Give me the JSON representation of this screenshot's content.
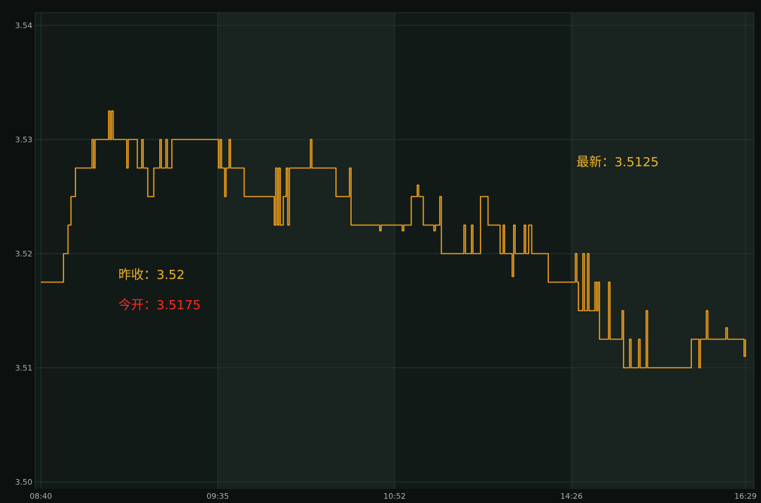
{
  "chart_data": {
    "type": "line",
    "title": "",
    "xlabel": "",
    "ylabel": "",
    "x_ticks": [
      "08:40",
      "09:35",
      "10:52",
      "14:26",
      "16:29"
    ],
    "y_ticks": [
      "3.50",
      "3.51",
      "3.52",
      "3.53",
      "3.54"
    ],
    "ylim": [
      3.5,
      3.54
    ],
    "grid": true,
    "colors": {
      "background": "#0c100f",
      "plot_band_dark": "#121a18",
      "plot_band_light": "#19231f",
      "grid": "#1f3a33",
      "line": "#f5a21c",
      "label_gold": "#f0b429",
      "label_red": "#ff2d1f",
      "axis_text": "#a7b3b0"
    },
    "annotations": [
      {
        "id": "prev-close",
        "label": "昨收：",
        "value": "3.52",
        "color": "label_gold"
      },
      {
        "id": "open",
        "label": "今开：",
        "value": "3.5175",
        "color": "label_red"
      },
      {
        "id": "latest",
        "label": "最新：",
        "value": "3.5125",
        "color": "label_gold"
      }
    ],
    "series": [
      {
        "values": [
          3.5175,
          3.5175,
          3.5175,
          3.5175,
          3.5175,
          3.5175,
          3.5175,
          3.5175,
          3.5175,
          3.5175,
          3.5175,
          3.5175,
          3.5175,
          3.5175,
          3.5175,
          3.52,
          3.52,
          3.52,
          3.5225,
          3.5225,
          3.525,
          3.525,
          3.525,
          3.5275,
          3.5275,
          3.5275,
          3.5275,
          3.5275,
          3.5275,
          3.5275,
          3.5275,
          3.5275,
          3.5275,
          3.5275,
          3.53,
          3.5275,
          3.53,
          3.53,
          3.53,
          3.53,
          3.53,
          3.53,
          3.53,
          3.53,
          3.53,
          3.5325,
          3.53,
          3.5325,
          3.53,
          3.53,
          3.53,
          3.53,
          3.53,
          3.53,
          3.53,
          3.53,
          3.53,
          3.5275,
          3.53,
          3.53,
          3.53,
          3.53,
          3.53,
          3.53,
          3.5275,
          3.5275,
          3.5275,
          3.53,
          3.5275,
          3.5275,
          3.5275,
          3.525,
          3.525,
          3.525,
          3.525,
          3.5275,
          3.5275,
          3.5275,
          3.5275,
          3.53,
          3.5275,
          3.5275,
          3.5275,
          3.53,
          3.5275,
          3.5275,
          3.5275,
          3.53,
          3.53,
          3.53,
          3.53,
          3.53,
          3.53,
          3.53,
          3.53,
          3.53,
          3.53,
          3.53,
          3.53,
          3.53,
          3.53,
          3.53,
          3.53,
          3.53,
          3.53,
          3.53,
          3.53,
          3.53,
          3.53,
          3.53,
          3.53,
          3.53,
          3.53,
          3.53,
          3.53,
          3.53,
          3.53,
          3.53,
          3.5275,
          3.53,
          3.5275,
          3.5275,
          3.525,
          3.5275,
          3.5275,
          3.53,
          3.5275,
          3.5275,
          3.5275,
          3.5275,
          3.5275,
          3.5275,
          3.5275,
          3.5275,
          3.5275,
          3.525,
          3.525,
          3.525,
          3.525,
          3.525,
          3.525,
          3.525,
          3.525,
          3.525,
          3.525,
          3.525,
          3.525,
          3.525,
          3.525,
          3.525,
          3.525,
          3.525,
          3.525,
          3.525,
          3.525,
          3.5225,
          3.5275,
          3.5225,
          3.5275,
          3.5225,
          3.5225,
          3.525,
          3.525,
          3.5275,
          3.5225,
          3.5275,
          3.5275,
          3.5275,
          3.5275,
          3.5275,
          3.5275,
          3.5275,
          3.5275,
          3.5275,
          3.5275,
          3.5275,
          3.5275,
          3.5275,
          3.5275,
          3.53,
          3.5275,
          3.5275,
          3.5275,
          3.5275,
          3.5275,
          3.5275,
          3.5275,
          3.5275,
          3.5275,
          3.5275,
          3.5275,
          3.5275,
          3.5275,
          3.5275,
          3.5275,
          3.5275,
          3.525,
          3.525,
          3.525,
          3.525,
          3.525,
          3.525,
          3.525,
          3.525,
          3.525,
          3.5275,
          3.5225,
          3.5225,
          3.5225,
          3.5225,
          3.5225,
          3.5225,
          3.5225,
          3.5225,
          3.5225,
          3.5225,
          3.5225,
          3.5225,
          3.5225,
          3.5225,
          3.5225,
          3.5225,
          3.5225,
          3.5225,
          3.5225,
          3.522,
          3.5225,
          3.5225,
          3.5225,
          3.5225,
          3.5225,
          3.5225,
          3.5225,
          3.5225,
          3.5225,
          3.5225,
          3.5225,
          3.5225,
          3.5225,
          3.5225,
          3.522,
          3.5225,
          3.5225,
          3.5225,
          3.5225,
          3.5225,
          3.525,
          3.525,
          3.525,
          3.525,
          3.526,
          3.525,
          3.525,
          3.525,
          3.5225,
          3.5225,
          3.5225,
          3.5225,
          3.5225,
          3.5225,
          3.5225,
          3.522,
          3.5225,
          3.5225,
          3.5225,
          3.525,
          3.52,
          3.52,
          3.52,
          3.52,
          3.52,
          3.52,
          3.52,
          3.52,
          3.52,
          3.52,
          3.52,
          3.52,
          3.52,
          3.52,
          3.52,
          3.5225,
          3.52,
          3.52,
          3.52,
          3.52,
          3.5225,
          3.52,
          3.52,
          3.52,
          3.52,
          3.52,
          3.525,
          3.525,
          3.525,
          3.525,
          3.525,
          3.5225,
          3.5225,
          3.5225,
          3.5225,
          3.5225,
          3.5225,
          3.5225,
          3.5225,
          3.52,
          3.52,
          3.5225,
          3.52,
          3.52,
          3.52,
          3.52,
          3.52,
          3.518,
          3.5225,
          3.52,
          3.52,
          3.52,
          3.52,
          3.52,
          3.52,
          3.5225,
          3.52,
          3.52,
          3.5225,
          3.5225,
          3.52,
          3.52,
          3.52,
          3.52,
          3.52,
          3.52,
          3.52,
          3.52,
          3.52,
          3.52,
          3.52,
          3.5175,
          3.5175,
          3.5175,
          3.5175,
          3.5175,
          3.5175,
          3.5175,
          3.5175,
          3.5175,
          3.5175,
          3.5175,
          3.5175,
          3.5175,
          3.5175,
          3.5175,
          3.5175,
          3.5175,
          3.5175,
          3.52,
          3.5175,
          3.515,
          3.515,
          3.515,
          3.52,
          3.515,
          3.515,
          3.52,
          3.515,
          3.515,
          3.515,
          3.515,
          3.5175,
          3.515,
          3.5175,
          3.5125,
          3.5125,
          3.5125,
          3.5125,
          3.5125,
          3.5125,
          3.5175,
          3.5125,
          3.5125,
          3.5125,
          3.5125,
          3.5125,
          3.5125,
          3.5125,
          3.5125,
          3.515,
          3.51,
          3.51,
          3.51,
          3.51,
          3.5125,
          3.51,
          3.51,
          3.51,
          3.51,
          3.51,
          3.5125,
          3.51,
          3.51,
          3.51,
          3.51,
          3.515,
          3.51,
          3.51,
          3.51,
          3.51,
          3.51,
          3.51,
          3.51,
          3.51,
          3.51,
          3.51,
          3.51,
          3.51,
          3.51,
          3.51,
          3.51,
          3.51,
          3.51,
          3.51,
          3.51,
          3.51,
          3.51,
          3.51,
          3.51,
          3.51,
          3.51,
          3.51,
          3.51,
          3.51,
          3.51,
          3.5125,
          3.5125,
          3.5125,
          3.5125,
          3.5125,
          3.51,
          3.5125,
          3.5125,
          3.5125,
          3.5125,
          3.515,
          3.5125,
          3.5125,
          3.5125,
          3.5125,
          3.5125,
          3.5125,
          3.5125,
          3.5125,
          3.5125,
          3.5125,
          3.5125,
          3.5125,
          3.5135,
          3.5125,
          3.5125,
          3.5125,
          3.5125,
          3.5125,
          3.5125,
          3.5125,
          3.5125,
          3.5125,
          3.5125,
          3.5125,
          3.511,
          3.5125
        ]
      }
    ]
  }
}
